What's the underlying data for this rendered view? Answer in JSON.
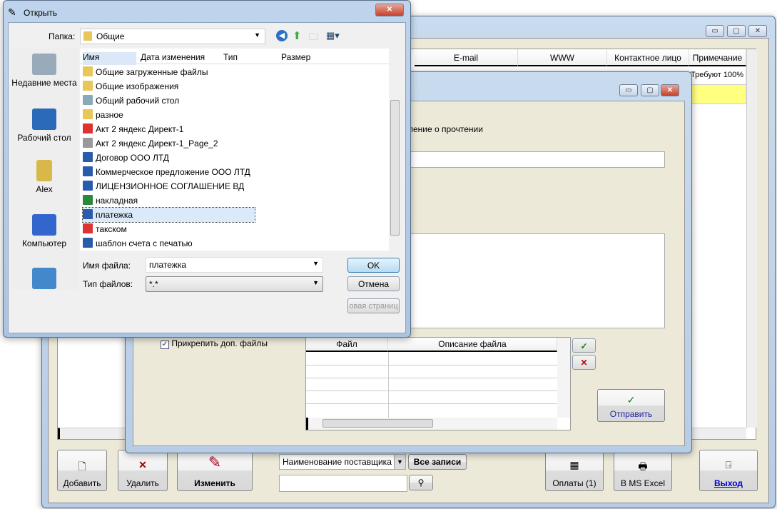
{
  "main_window": {
    "grid": {
      "columns": [
        "E-mail",
        "WWW",
        "Контактное лицо",
        "Примечание"
      ],
      "rows": [
        {
          "note": "Требуют 100%"
        }
      ]
    },
    "toolbar": {
      "add": "Добавить",
      "delete": "Удалить",
      "edit": "Изменить",
      "search_field": "Наименование поставщика",
      "all_records": "Все записи",
      "search_value": "",
      "payments": "Оплаты (1)",
      "excel": "В MS Excel",
      "exit": "Выход"
    }
  },
  "mail_dialog": {
    "read_receipt_label": "ление о прочтении",
    "subject_value": "",
    "body_value": "",
    "attach_checkbox": "Прикрепить доп. файлы",
    "attach_checked": true,
    "files_grid": {
      "columns": [
        "Файл",
        "Описание файла"
      ]
    },
    "send": "Отправить"
  },
  "open_dialog": {
    "title": "Открыть",
    "folder_label": "Папка:",
    "folder_value": "Общие",
    "columns": [
      "Имя",
      "Дата изменения",
      "Тип",
      "Размер"
    ],
    "places": [
      "Недавние места",
      "Рабочий стол",
      "Alex",
      "Компьютер",
      ""
    ],
    "files": [
      {
        "name": "Общие загруженные файлы",
        "icon": "folder"
      },
      {
        "name": "Общие изображения",
        "icon": "folder"
      },
      {
        "name": "Общий рабочий стол",
        "icon": "desktop"
      },
      {
        "name": "разное",
        "icon": "folder"
      },
      {
        "name": "Акт 2 яндекс Директ-1",
        "icon": "pdf"
      },
      {
        "name": "Акт 2 яндекс Директ-1_Page_2",
        "icon": "image"
      },
      {
        "name": "Договор ООО ЛТД",
        "icon": "word"
      },
      {
        "name": "Коммерческое предложение ООО ЛТД",
        "icon": "word"
      },
      {
        "name": "ЛИЦЕНЗИОННОЕ СОГЛАШЕНИЕ ВД",
        "icon": "word"
      },
      {
        "name": "накладная",
        "icon": "excel"
      },
      {
        "name": "платежка",
        "icon": "word",
        "selected": true
      },
      {
        "name": "такском",
        "icon": "pdf"
      },
      {
        "name": "шаблон счета с печатью",
        "icon": "word"
      }
    ],
    "filename_label": "Имя файла:",
    "filename_value": "платежка",
    "filetype_label": "Тип файлов:",
    "filetype_value": "*.*",
    "ok": "OK",
    "cancel": "Отмена",
    "extra_button": "овая страниц"
  }
}
